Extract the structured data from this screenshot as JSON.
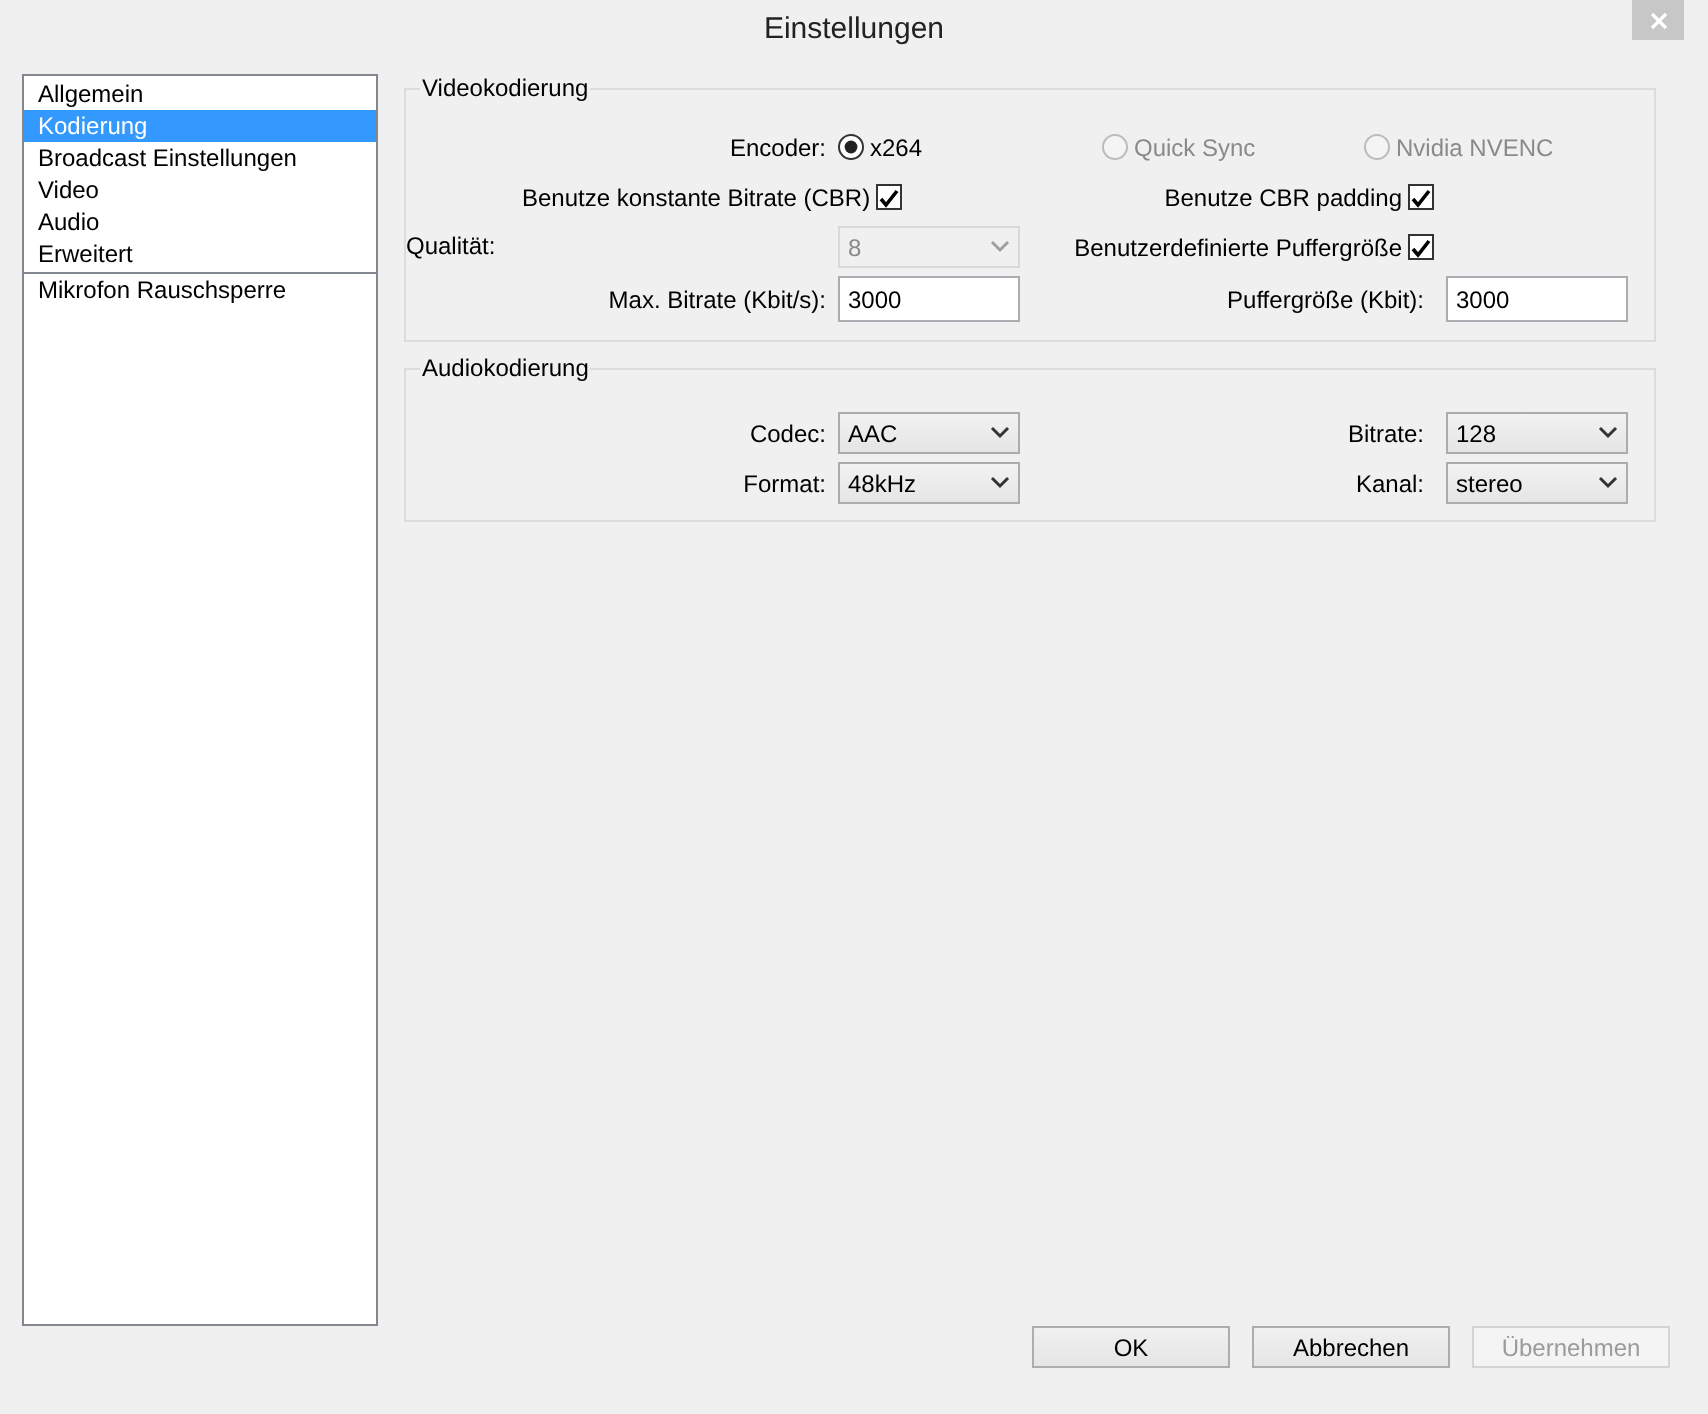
{
  "window": {
    "title": "Einstellungen"
  },
  "sidebar": {
    "items": [
      {
        "label": "Allgemein",
        "selected": false,
        "separator_before": false
      },
      {
        "label": "Kodierung",
        "selected": true,
        "separator_before": false
      },
      {
        "label": "Broadcast Einstellungen",
        "selected": false,
        "separator_before": false
      },
      {
        "label": "Video",
        "selected": false,
        "separator_before": false
      },
      {
        "label": "Audio",
        "selected": false,
        "separator_before": false
      },
      {
        "label": "Erweitert",
        "selected": false,
        "separator_before": false
      },
      {
        "label": "Mikrofon Rauschsperre",
        "selected": false,
        "separator_before": true
      }
    ]
  },
  "video": {
    "title": "Videokodierung",
    "encoder": {
      "label": "Encoder:",
      "options": [
        {
          "label": "x264",
          "selected": true,
          "disabled": false
        },
        {
          "label": "Quick Sync",
          "selected": false,
          "disabled": true
        },
        {
          "label": "Nvidia NVENC",
          "selected": false,
          "disabled": true
        }
      ]
    },
    "cbr": {
      "label": "Benutze konstante Bitrate (CBR)",
      "checked": true
    },
    "cbr_padding": {
      "label": "Benutze CBR padding",
      "checked": true
    },
    "quality": {
      "label": "Qualität:",
      "value": "8",
      "disabled": true
    },
    "custom_buffer": {
      "label": "Benutzerdefinierte Puffergröße",
      "checked": true
    },
    "max_bitrate": {
      "label": "Max. Bitrate (Kbit/s):",
      "value": "3000"
    },
    "buffer_size": {
      "label": "Puffergröße (Kbit):",
      "value": "3000"
    }
  },
  "audio": {
    "title": "Audiokodierung",
    "codec": {
      "label": "Codec:",
      "value": "AAC",
      "disabled": false
    },
    "bitrate": {
      "label": "Bitrate:",
      "value": "128",
      "disabled": false
    },
    "format": {
      "label": "Format:",
      "value": "48kHz",
      "disabled": false
    },
    "channel": {
      "label": "Kanal:",
      "value": "stereo",
      "disabled": false
    }
  },
  "buttons": [
    {
      "label": "OK",
      "disabled": false
    },
    {
      "label": "Abbrechen",
      "disabled": false
    },
    {
      "label": "Übernehmen",
      "disabled": true
    }
  ]
}
